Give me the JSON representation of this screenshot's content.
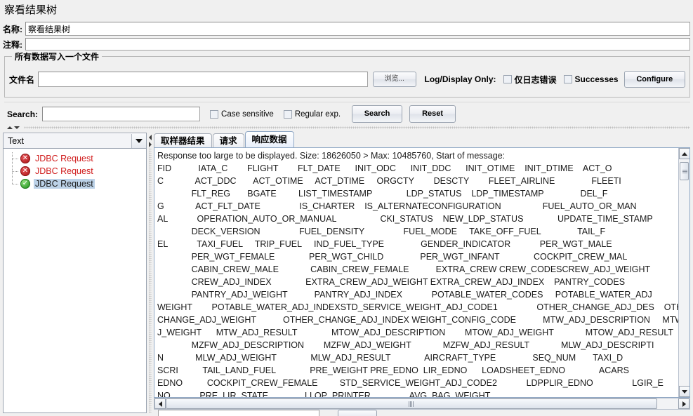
{
  "window": {
    "title": "察看结果树"
  },
  "form": {
    "name_label": "名称:",
    "name_value": "察看结果树",
    "comment_label": "注释:",
    "comment_value": ""
  },
  "file_group": {
    "legend": "所有数据写入一个文件",
    "filename_label": "文件名",
    "filename_value": "",
    "browse_button": "浏览...",
    "log_display_label": "Log/Display Only:",
    "errors_only_checkbox": "仅日志错误",
    "errors_only_checked": false,
    "successes_checkbox": "Successes",
    "successes_checked": false,
    "configure_button": "Configure"
  },
  "search": {
    "label": "Search:",
    "value": "",
    "case_sensitive_label": "Case sensitive",
    "case_sensitive_checked": false,
    "regular_exp_label": "Regular exp.",
    "regular_exp_checked": false,
    "search_button": "Search",
    "reset_button": "Reset"
  },
  "left_pane": {
    "render_selector": "Text",
    "tree_items": [
      {
        "label": "JDBC Request",
        "status": "fail",
        "selected": false
      },
      {
        "label": "JDBC Request",
        "status": "fail",
        "selected": false
      },
      {
        "label": "JDBC Request",
        "status": "pass",
        "selected": true
      }
    ]
  },
  "right_pane": {
    "tabs": [
      {
        "label": "取样器结果",
        "active": false
      },
      {
        "label": "请求",
        "active": false
      },
      {
        "label": "响应数据",
        "active": true
      }
    ],
    "response_header": "Response too large to be displayed. Size: 18626050 > Max: 10485760, Start of message:",
    "response_lines": [
      "FID           IATA_C        FLIGHT        FLT_DATE      INIT_ODC      INIT_DDC      INIT_OTIME    INIT_DTIME    ACT_O",
      "C             ACT_DDC       ACT_OTIME     ACT_DTIME     ORGCTY        DESCTY        FLEET_AIRLINE               FLEETI",
      "              FLT_REG       BGATE         LIST_TIMESTAMP              LDP_STATUS    LDP_TIMESTAMP               DEL_F",
      "G             ACT_FLT_DATE                IS_CHARTER    IS_ALTERNATECONFIGURATION                 FUEL_AUTO_OR_MAN",
      "AL            OPERATION_AUTO_OR_MANUAL                  CKI_STATUS    NEW_LDP_STATUS              UPDATE_TIME_STAMP",
      "              DECK_VERSION                FUEL_DENSITY                FUEL_MODE     TAKE_OFF_FUEL               TAIL_F",
      "EL            TAXI_FUEL     TRIP_FUEL     IND_FUEL_TYPE               GENDER_INDICATOR            PER_WGT_MALE",
      "              PER_WGT_FEMALE              PER_WGT_CHILD               PER_WGT_INFANT              COCKPIT_CREW_MAL",
      "              CABIN_CREW_MALE             CABIN_CREW_FEMALE           EXTRA_CREW CREW_CODESCREW_ADJ_WEIGHT",
      "              CREW_ADJ_INDEX              EXTRA_CREW_ADJ_WEIGHT EXTRA_CREW_ADJ_INDEX    PANTRY_CODES",
      "              PANTRY_ADJ_WEIGHT           PANTRY_ADJ_INDEX            POTABLE_WATER_CODES     POTABLE_WATER_ADJ",
      "WEIGHT        POTABLE_WATER_ADJ_INDEXSTD_SERVICE_WEIGHT_ADJ_CODE1                OTHER_CHANGE_ADJ_DES    OTHER",
      "CHANGE_ADJ_WEIGHT           OTHER_CHANGE_ADJ_INDEX WEIGHT_CONFIG_CODE           MTW_ADJ_DESCRIPTION     MTW_A",
      "J_WEIGHT      MTW_ADJ_RESULT              MTOW_ADJ_DESCRIPTION        MTOW_ADJ_WEIGHT             MTOW_ADJ_RESULT",
      "              MZFW_ADJ_DESCRIPTION        MZFW_ADJ_WEIGHT             MZFW_ADJ_RESULT             MLW_ADJ_DESCRIPTI",
      "N             MLW_ADJ_WEIGHT              MLW_ADJ_RESULT              AIRCRAFT_TYPE               SEQ_NUM       TAXI_D",
      "SCRI          TAIL_LAND_FUEL              PRE_WEIGHT PRE_EDNO  LIR_EDNO      LOADSHEET_EDNO              ACARS",
      "EDNO          COCKPIT_CREW_FEMALE         STD_SERVICE_WEIGHT_ADJ_CODE2            LDPPLIR_EDNO                LGIR_E",
      "NO            PRE_LIR_STATE               LLOP_PRINTER                AVG_BAG_WEIGHT"
    ]
  },
  "icons": {
    "combo_arrow": "chevron-down-icon",
    "browse": "browse-icon",
    "fail_status": "error-circle-icon",
    "pass_status": "success-circle-icon"
  },
  "colors": {
    "fail_text": "#d01b1b",
    "selection": "#bcd2e8",
    "tab_active": "#e6eefa"
  }
}
